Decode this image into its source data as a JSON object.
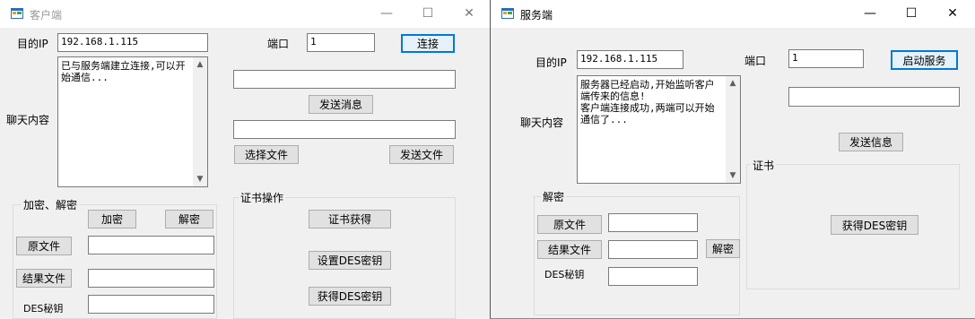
{
  "client": {
    "title": "客户端",
    "controls": {
      "minimize": "—",
      "maximize": "☐",
      "close": "✕"
    },
    "target_ip_label": "目的IP",
    "target_ip_value": "192.168.1.115",
    "port_label": "端口",
    "port_value": "1",
    "connect_button": "连接",
    "chat_label": "聊天内容",
    "chat_text": "已与服务端建立连接,可以开始通信...",
    "message_input": "",
    "send_message_button": "发送消息",
    "file_input": "",
    "choose_file_button": "选择文件",
    "send_file_button": "发送文件",
    "crypto_group": {
      "title": "加密、解密",
      "encrypt_button": "加密",
      "decrypt_button": "解密",
      "source_file_button": "原文件",
      "source_file_value": "",
      "result_file_button": "结果文件",
      "result_file_value": "",
      "des_key_label": "DES秘钥",
      "des_key_value": ""
    },
    "cert_group": {
      "title": "证书操作",
      "get_cert_button": "证书获得",
      "set_des_button": "设置DES密钥",
      "get_des_button": "获得DES密钥"
    }
  },
  "server": {
    "title": "服务端",
    "controls": {
      "minimize": "—",
      "maximize": "☐",
      "close": "✕"
    },
    "target_ip_label": "目的IP",
    "target_ip_value": "192.168.1.115",
    "port_label": "端口",
    "port_value": "1",
    "start_button": "启动服务",
    "chat_label": "聊天内容",
    "chat_text": "服务器已经启动,开始监听客户端传来的信息!\n客户端连接成功,两端可以开始通信了...",
    "message_input": "",
    "send_button": "发送信息",
    "decrypt_group": {
      "title": "解密",
      "source_file_button": "原文件",
      "source_file_value": "",
      "result_file_button": "结果文件",
      "result_file_value": "",
      "decrypt_button": "解密",
      "des_key_label": "DES秘钥",
      "des_key_value": ""
    },
    "cert_group": {
      "title": "证书",
      "get_des_button": "获得DES密钥"
    }
  }
}
